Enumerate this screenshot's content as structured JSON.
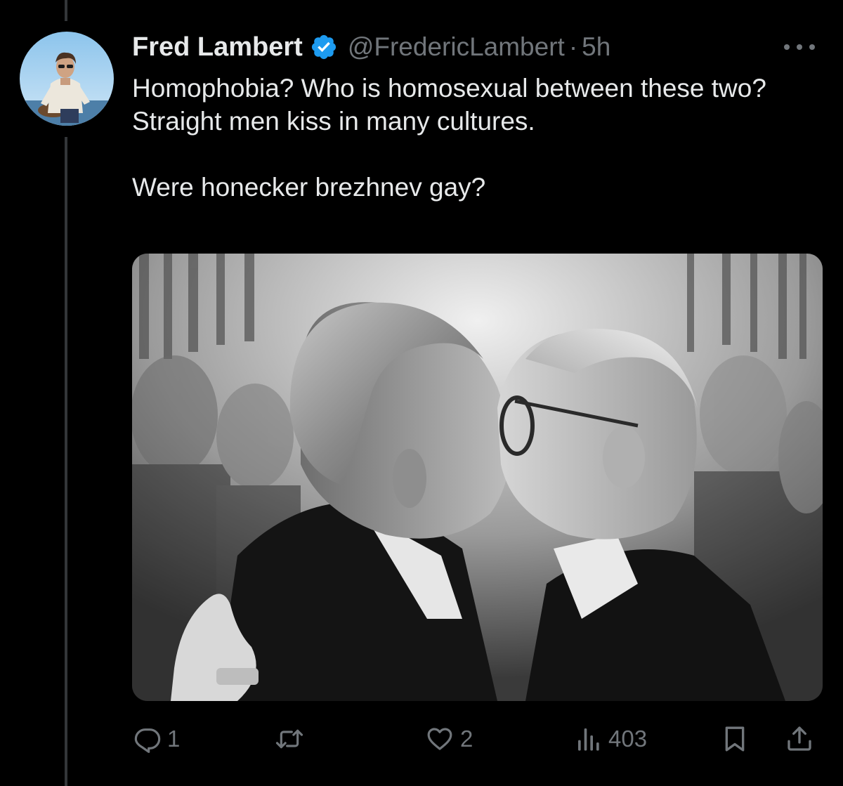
{
  "tweet": {
    "author": {
      "display_name": "Fred Lambert",
      "handle": "@FredericLambert",
      "verified": true
    },
    "separator": "·",
    "time_ago": "5h",
    "text_lines": [
      "Homophobia? Who is homosexual between these two? Straight men kiss in many cultures.",
      "Were honecker brezhnev gay?"
    ],
    "media": {
      "kind": "black-and-white photo"
    }
  },
  "actions": {
    "reply": {
      "icon": "reply-icon",
      "count": "1"
    },
    "repost": {
      "icon": "repost-icon",
      "count": ""
    },
    "like": {
      "icon": "heart-icon",
      "count": "2"
    },
    "views": {
      "icon": "views-chart-icon",
      "count": "403"
    },
    "bookmark": {
      "icon": "bookmark-icon"
    },
    "share": {
      "icon": "share-icon"
    }
  },
  "colors": {
    "background": "#000000",
    "text_primary": "#e7e9ea",
    "text_secondary": "#71767b",
    "verified_badge": "#1d9bf0",
    "thread_line": "#333639"
  }
}
